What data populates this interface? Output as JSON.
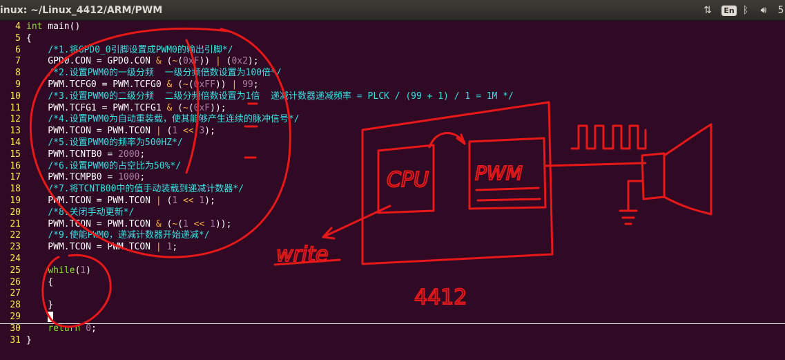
{
  "window": {
    "title": "inux: ~/Linux_4412/ARM/PWM"
  },
  "tray": {
    "network_icon": "network-arrows-icon",
    "lang": "En",
    "bluetooth_icon": "bluetooth-icon",
    "volume_icon": "volume-icon",
    "partial": "5"
  },
  "colors": {
    "background": "#300a24",
    "line_numbers": "#fce94f",
    "comment": "#34e2e2",
    "keyword": "#8ae234",
    "number": "#ad7fa8",
    "annotation": "#e81818"
  },
  "code": {
    "lines": [
      {
        "n": "4",
        "t": "int main()"
      },
      {
        "n": "5",
        "t": "{"
      },
      {
        "n": "6",
        "t": "    /*1.将GPD0_0引脚设置成PWM0的输出引脚*/"
      },
      {
        "n": "7",
        "t": "    GPD0.CON = GPD0.CON & (~(0xF)) | (0x2);"
      },
      {
        "n": "8",
        "t": "    /*2.设置PWM0的一级分频  一级分频倍数设置为100倍*/"
      },
      {
        "n": "9",
        "t": "    PWM.TCFG0 = PWM.TCFG0 & (~(0xFF)) | 99;"
      },
      {
        "n": "10",
        "t": "    /*3.设置PWM0的二级分频  二级分频倍数设置为1倍  递减计数器递减频率 = PLCK / (99 + 1) / 1 = 1M */"
      },
      {
        "n": "11",
        "t": "    PWM.TCFG1 = PWM.TCFG1 & (~(0xF));"
      },
      {
        "n": "12",
        "t": "    /*4.设置PWM0为自动重装载，使其能够产生连续的脉冲信号*/"
      },
      {
        "n": "13",
        "t": "    PWM.TCON = PWM.TCON | (1 << 3);"
      },
      {
        "n": "14",
        "t": "    /*5.设置PWM0的频率为500HZ*/"
      },
      {
        "n": "15",
        "t": "    PWM.TCNTB0 = 2000;"
      },
      {
        "n": "16",
        "t": "    /*6.设置PWM0的占空比为50%*/"
      },
      {
        "n": "17",
        "t": "    PWM.TCMPB0 = 1000;"
      },
      {
        "n": "18",
        "t": "    /*7.将TCNTB00中的值手动装载到递减计数器*/"
      },
      {
        "n": "19",
        "t": "    PWM.TCON = PWM.TCON | (1 << 1);"
      },
      {
        "n": "20",
        "t": "    /*8.关闭手动更新*/"
      },
      {
        "n": "21",
        "t": "    PWM.TCON = PWM.TCON & (~(1 << 1));"
      },
      {
        "n": "22",
        "t": "    /*9.使能PWM0，递减计数器开始递减*/"
      },
      {
        "n": "23",
        "t": "    PWM.TCON = PWM.TCON | 1;"
      },
      {
        "n": "24",
        "t": ""
      },
      {
        "n": "25",
        "t": "    while(1)"
      },
      {
        "n": "26",
        "t": "    {"
      },
      {
        "n": "27",
        "t": ""
      },
      {
        "n": "28",
        "t": "    }"
      },
      {
        "n": "29",
        "t": ""
      },
      {
        "n": "30",
        "t": "    return 0;"
      },
      {
        "n": "31",
        "t": "}"
      }
    ]
  },
  "annotations": {
    "cpu": "CPU",
    "pwm": "PWM",
    "write": "write",
    "chip": "4412",
    "signal": "square-wave-signal",
    "speaker": "buzzer-speaker",
    "ground": "ground-symbol"
  }
}
